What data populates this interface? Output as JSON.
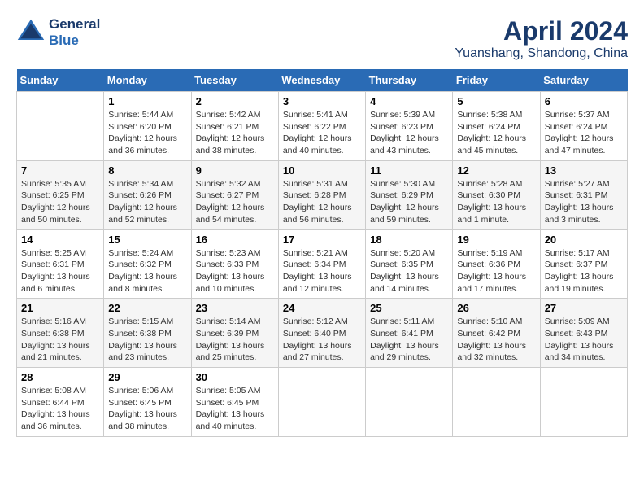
{
  "header": {
    "logo_line1": "General",
    "logo_line2": "Blue",
    "title": "April 2024",
    "subtitle": "Yuanshang, Shandong, China"
  },
  "days_header": [
    "Sunday",
    "Monday",
    "Tuesday",
    "Wednesday",
    "Thursday",
    "Friday",
    "Saturday"
  ],
  "weeks": [
    [
      {
        "day": "",
        "info": ""
      },
      {
        "day": "1",
        "info": "Sunrise: 5:44 AM\nSunset: 6:20 PM\nDaylight: 12 hours\nand 36 minutes."
      },
      {
        "day": "2",
        "info": "Sunrise: 5:42 AM\nSunset: 6:21 PM\nDaylight: 12 hours\nand 38 minutes."
      },
      {
        "day": "3",
        "info": "Sunrise: 5:41 AM\nSunset: 6:22 PM\nDaylight: 12 hours\nand 40 minutes."
      },
      {
        "day": "4",
        "info": "Sunrise: 5:39 AM\nSunset: 6:23 PM\nDaylight: 12 hours\nand 43 minutes."
      },
      {
        "day": "5",
        "info": "Sunrise: 5:38 AM\nSunset: 6:24 PM\nDaylight: 12 hours\nand 45 minutes."
      },
      {
        "day": "6",
        "info": "Sunrise: 5:37 AM\nSunset: 6:24 PM\nDaylight: 12 hours\nand 47 minutes."
      }
    ],
    [
      {
        "day": "7",
        "info": "Sunrise: 5:35 AM\nSunset: 6:25 PM\nDaylight: 12 hours\nand 50 minutes."
      },
      {
        "day": "8",
        "info": "Sunrise: 5:34 AM\nSunset: 6:26 PM\nDaylight: 12 hours\nand 52 minutes."
      },
      {
        "day": "9",
        "info": "Sunrise: 5:32 AM\nSunset: 6:27 PM\nDaylight: 12 hours\nand 54 minutes."
      },
      {
        "day": "10",
        "info": "Sunrise: 5:31 AM\nSunset: 6:28 PM\nDaylight: 12 hours\nand 56 minutes."
      },
      {
        "day": "11",
        "info": "Sunrise: 5:30 AM\nSunset: 6:29 PM\nDaylight: 12 hours\nand 59 minutes."
      },
      {
        "day": "12",
        "info": "Sunrise: 5:28 AM\nSunset: 6:30 PM\nDaylight: 13 hours\nand 1 minute."
      },
      {
        "day": "13",
        "info": "Sunrise: 5:27 AM\nSunset: 6:31 PM\nDaylight: 13 hours\nand 3 minutes."
      }
    ],
    [
      {
        "day": "14",
        "info": "Sunrise: 5:25 AM\nSunset: 6:31 PM\nDaylight: 13 hours\nand 6 minutes."
      },
      {
        "day": "15",
        "info": "Sunrise: 5:24 AM\nSunset: 6:32 PM\nDaylight: 13 hours\nand 8 minutes."
      },
      {
        "day": "16",
        "info": "Sunrise: 5:23 AM\nSunset: 6:33 PM\nDaylight: 13 hours\nand 10 minutes."
      },
      {
        "day": "17",
        "info": "Sunrise: 5:21 AM\nSunset: 6:34 PM\nDaylight: 13 hours\nand 12 minutes."
      },
      {
        "day": "18",
        "info": "Sunrise: 5:20 AM\nSunset: 6:35 PM\nDaylight: 13 hours\nand 14 minutes."
      },
      {
        "day": "19",
        "info": "Sunrise: 5:19 AM\nSunset: 6:36 PM\nDaylight: 13 hours\nand 17 minutes."
      },
      {
        "day": "20",
        "info": "Sunrise: 5:17 AM\nSunset: 6:37 PM\nDaylight: 13 hours\nand 19 minutes."
      }
    ],
    [
      {
        "day": "21",
        "info": "Sunrise: 5:16 AM\nSunset: 6:38 PM\nDaylight: 13 hours\nand 21 minutes."
      },
      {
        "day": "22",
        "info": "Sunrise: 5:15 AM\nSunset: 6:38 PM\nDaylight: 13 hours\nand 23 minutes."
      },
      {
        "day": "23",
        "info": "Sunrise: 5:14 AM\nSunset: 6:39 PM\nDaylight: 13 hours\nand 25 minutes."
      },
      {
        "day": "24",
        "info": "Sunrise: 5:12 AM\nSunset: 6:40 PM\nDaylight: 13 hours\nand 27 minutes."
      },
      {
        "day": "25",
        "info": "Sunrise: 5:11 AM\nSunset: 6:41 PM\nDaylight: 13 hours\nand 29 minutes."
      },
      {
        "day": "26",
        "info": "Sunrise: 5:10 AM\nSunset: 6:42 PM\nDaylight: 13 hours\nand 32 minutes."
      },
      {
        "day": "27",
        "info": "Sunrise: 5:09 AM\nSunset: 6:43 PM\nDaylight: 13 hours\nand 34 minutes."
      }
    ],
    [
      {
        "day": "28",
        "info": "Sunrise: 5:08 AM\nSunset: 6:44 PM\nDaylight: 13 hours\nand 36 minutes."
      },
      {
        "day": "29",
        "info": "Sunrise: 5:06 AM\nSunset: 6:45 PM\nDaylight: 13 hours\nand 38 minutes."
      },
      {
        "day": "30",
        "info": "Sunrise: 5:05 AM\nSunset: 6:45 PM\nDaylight: 13 hours\nand 40 minutes."
      },
      {
        "day": "",
        "info": ""
      },
      {
        "day": "",
        "info": ""
      },
      {
        "day": "",
        "info": ""
      },
      {
        "day": "",
        "info": ""
      }
    ]
  ]
}
